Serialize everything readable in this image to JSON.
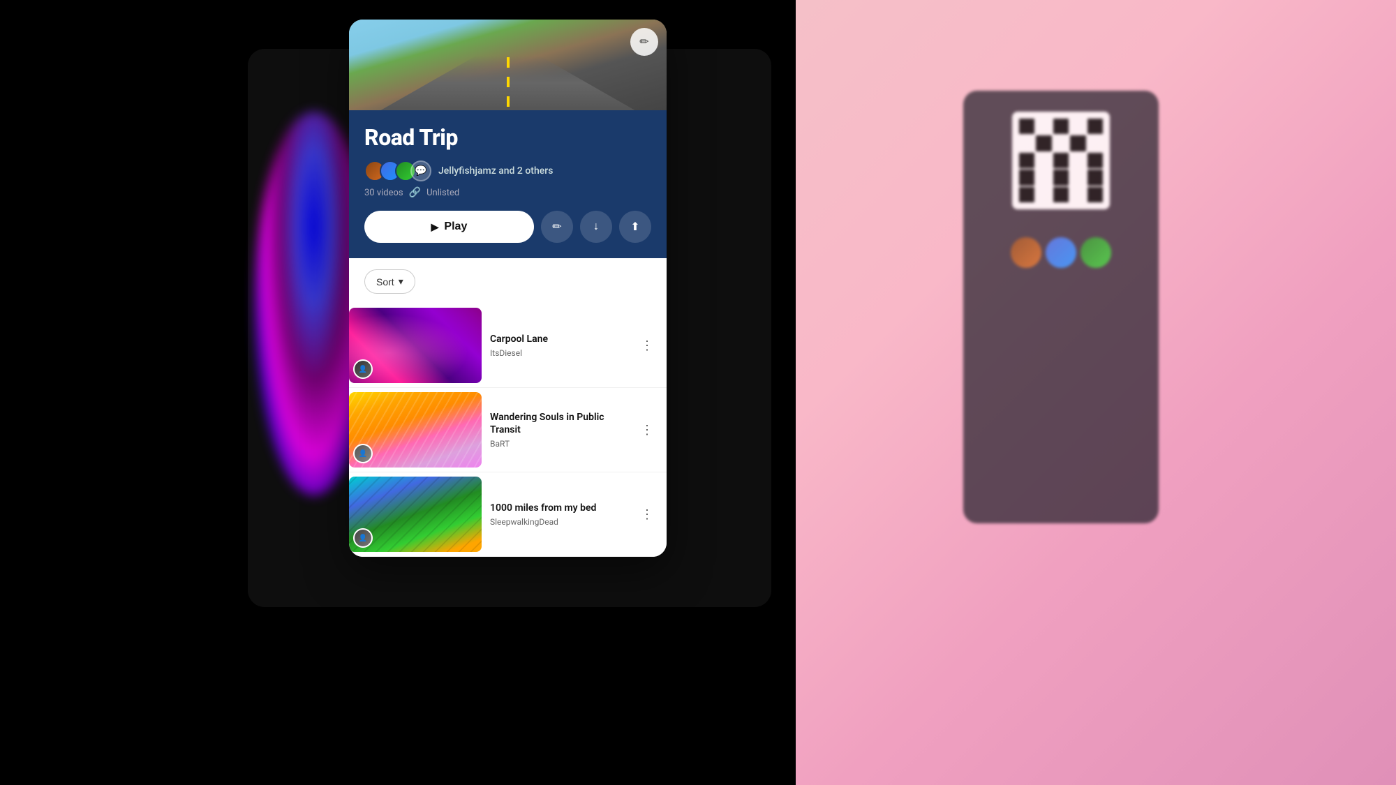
{
  "background": {
    "leftColor": "#000",
    "rightColor": "#f5c0c8"
  },
  "playlist": {
    "title": "Road Trip",
    "collaborators": "Jellyfishjamz and 2 others",
    "videoCount": "30 videos",
    "visibility": "Unlisted",
    "editButtonLabel": "✏",
    "playButtonLabel": "Play"
  },
  "actions": {
    "edit": "✏",
    "download": "⬇",
    "share": "↗"
  },
  "sort": {
    "label": "Sort",
    "chevron": "⌄"
  },
  "videos": [
    {
      "title": "Carpool Lane",
      "channel": "ItsDiesel",
      "thumbType": "swirl"
    },
    {
      "title": "Wandering Souls in Public Transit",
      "channel": "BaRT",
      "thumbType": "gradient2"
    },
    {
      "title": "1000 miles from my bed",
      "channel": "SleepwalkingDead",
      "thumbType": "gradient3"
    }
  ],
  "icons": {
    "play": "▶",
    "pencil": "✏",
    "download": "↓",
    "share": "⬆",
    "link": "🔗",
    "chevronDown": "▾",
    "moreVert": "⋮"
  }
}
